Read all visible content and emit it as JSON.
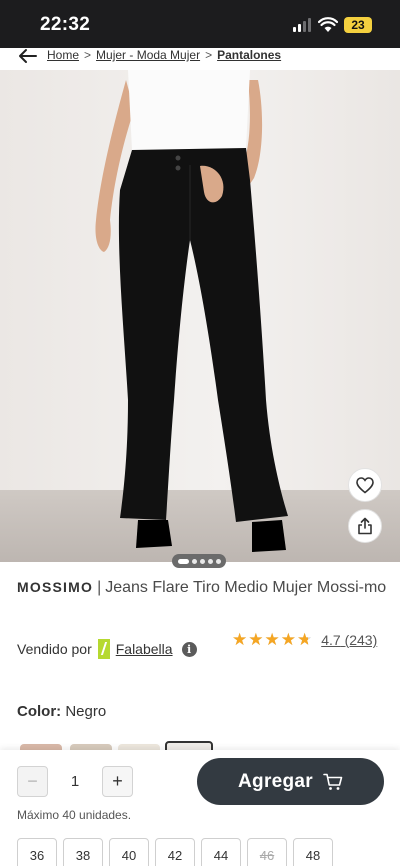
{
  "status_bar": {
    "time": "22:32",
    "battery": "23"
  },
  "breadcrumb": {
    "items": [
      "Home",
      "Mujer - Moda Mujer"
    ],
    "current": "Pantalones",
    "separator": ">"
  },
  "product": {
    "brand": "MOSSIMO",
    "separator": "|",
    "name": "Jeans Flare Tiro Medio Mujer Mossi-mo",
    "image_alt_icon": "product-photo",
    "carousel_slide": 1,
    "carousel_total": 5
  },
  "seller": {
    "label": "Vendido por",
    "name": "Falabella",
    "logo_color": "#b6d930",
    "info_glyph": "i"
  },
  "rating": {
    "stars": 4.7,
    "value": "4.7",
    "count": "(243)",
    "star_color": "#f5a623"
  },
  "color": {
    "label": "Color:",
    "value": "Negro"
  },
  "swatches": [
    {
      "color": "#d9b9a8"
    },
    {
      "color": "#d8cbbd"
    },
    {
      "color": "#ede7dd"
    },
    {
      "color": "#f0ede9"
    }
  ],
  "cart": {
    "minus": "−",
    "plus": "+",
    "quantity": "1",
    "add_label": "Agregar",
    "max_note": "Máximo 40 unidades.",
    "button_color": "#333a41"
  },
  "sizes": [
    {
      "label": "36",
      "available": true
    },
    {
      "label": "38",
      "available": true
    },
    {
      "label": "40",
      "available": true
    },
    {
      "label": "42",
      "available": true
    },
    {
      "label": "44",
      "available": true
    },
    {
      "label": "46",
      "available": false
    },
    {
      "label": "48",
      "available": true
    }
  ]
}
